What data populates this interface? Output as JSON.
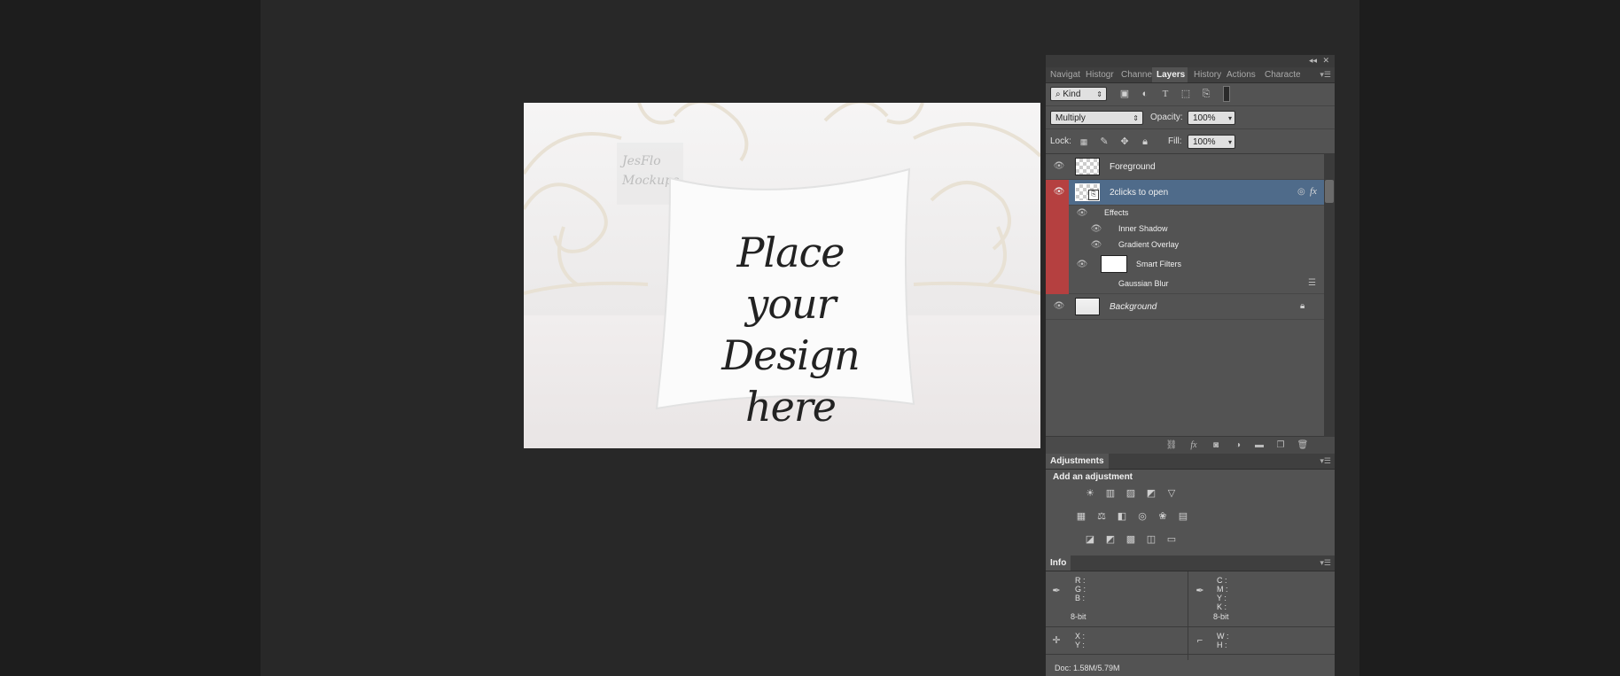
{
  "layers_panel": {
    "tabs": [
      "Navigat",
      "Histogr",
      "Channe",
      "Layers",
      "History",
      "Actions",
      "Characte"
    ],
    "active_tab": "Layers",
    "filter_kind": "Kind",
    "blend_mode": "Multiply",
    "opacity_label": "Opacity:",
    "opacity_value": "100%",
    "lock_label": "Lock:",
    "fill_label": "Fill:",
    "fill_value": "100%",
    "layers": {
      "foreground": "Foreground",
      "smart_object": "2clicks to open",
      "effects": "Effects",
      "inner_shadow": "Inner Shadow",
      "gradient_overlay": "Gradient Overlay",
      "smart_filters": "Smart Filters",
      "gaussian_blur": "Gaussian Blur",
      "background": "Background"
    },
    "fx_symbol": "fx"
  },
  "adjustments_panel": {
    "tab": "Adjustments",
    "heading": "Add an adjustment"
  },
  "info_panel": {
    "tab": "Info",
    "rgb_labels": [
      "R :",
      "G :",
      "B :"
    ],
    "cmyk_labels": [
      "C :",
      "M :",
      "Y :",
      "K :"
    ],
    "bit_depth_left": "8-bit",
    "bit_depth_right": "8-bit",
    "xy_labels": [
      "X :",
      "Y :"
    ],
    "wh_labels": [
      "W :",
      "H :"
    ],
    "doc_size": "Doc: 1.58M/5.79M"
  },
  "canvas": {
    "watermark_text": "JesFlo Mockups",
    "pillow_text_line1": "Place your",
    "pillow_text_line2": "Design here"
  },
  "colors": {
    "panel_bg": "#535353",
    "selected_layer": "#4f6b8a",
    "red_highlight": "#b54040",
    "workspace": "#282828"
  }
}
